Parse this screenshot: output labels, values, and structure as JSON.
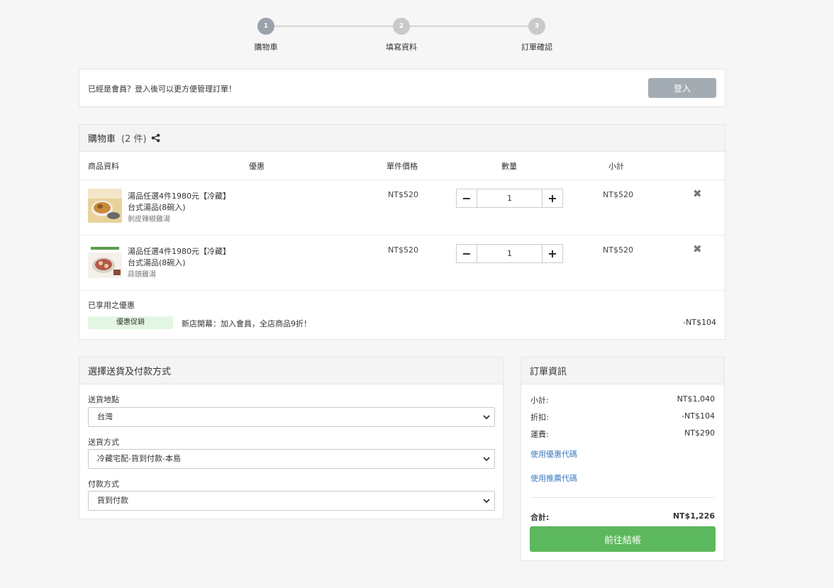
{
  "stepper": {
    "steps": [
      {
        "number": "1",
        "label": "購物車"
      },
      {
        "number": "2",
        "label": "填寫資料"
      },
      {
        "number": "3",
        "label": "訂單確認"
      }
    ],
    "active_step": 1
  },
  "login": {
    "message": "已經是會員？登入後可以更方便管理訂單！",
    "button_label": "登入"
  },
  "cart": {
    "title": "購物車",
    "count_label": "(2 件)",
    "columns": {
      "product": "商品資料",
      "discount": "優惠",
      "unit_price": "單件價格",
      "quantity": "數量",
      "subtotal": "小計"
    },
    "items": [
      {
        "title": "湯品任選4件1980元【冷藏】",
        "variant": "台式湯品(8碗入)",
        "flavor": "剝皮辣椒雞湯",
        "price": "NT$520",
        "quantity": "1",
        "subtotal": "NT$520"
      },
      {
        "title": "湯品任選4件1980元【冷藏】",
        "variant": "台式湯品(8碗入)",
        "flavor": "蒜頭雞湯",
        "price": "NT$520",
        "quantity": "1",
        "subtotal": "NT$520"
      }
    ],
    "applied_promos_title": "已享用之優惠",
    "promo_tag": "優惠促銷",
    "promo_desc": "新店開幕：加入會員，全店商品9折！",
    "promo_amount": "-NT$104"
  },
  "shipping": {
    "title": "選擇送貨及付款方式",
    "destination_label": "送貨地點",
    "destination_value": "台灣",
    "method_label": "送貨方式",
    "method_value": "冷藏宅配-貨到付款-本島",
    "payment_label": "付款方式",
    "payment_value": "貨到付款"
  },
  "order": {
    "title": "訂單資訊",
    "subtotal_label": "小計:",
    "subtotal_value": "NT$1,040",
    "discount_label": "折扣:",
    "discount_value": "-NT$104",
    "shipping_label": "運費:",
    "shipping_value": "NT$290",
    "coupon_link": "使用優惠代碼",
    "referral_link": "使用推薦代碼",
    "total_label": "合計:",
    "total_value": "NT$1,226",
    "checkout_label": "前往結帳"
  },
  "colors": {
    "checkout_green": "#5cb85c",
    "link_blue": "#3a7bbf",
    "promo_tag_bg": "#e3f6e3",
    "active_step": "#9aa3ab"
  }
}
